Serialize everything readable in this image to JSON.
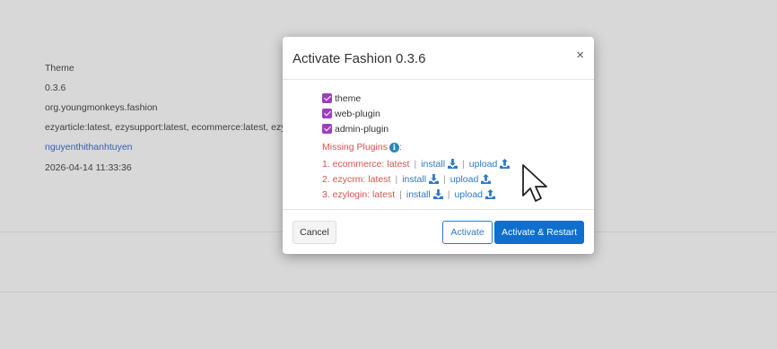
{
  "background": {
    "fields": [
      {
        "name": "theme-label",
        "text": "Theme"
      },
      {
        "name": "version-value",
        "text": "0.3.6"
      },
      {
        "name": "group-id-value",
        "text": "org.youngmonkeys.fashion"
      },
      {
        "name": "dependencies-value",
        "text": "ezyarticle:latest, ezysupport:latest, ecommerce:latest, ezy"
      },
      {
        "name": "author-link",
        "text": "nguyenthithanhtuyen"
      },
      {
        "name": "date-value",
        "text": "2026-04-14 11:33:36"
      }
    ]
  },
  "modal": {
    "title": "Activate Fashion 0.3.6",
    "close_symbol": "×",
    "checks": [
      {
        "label": "theme",
        "checked": true
      },
      {
        "label": "web-plugin",
        "checked": true
      },
      {
        "label": "admin-plugin",
        "checked": true
      }
    ],
    "missing_title": "Missing Plugins",
    "missing_suffix": ":",
    "info_symbol": "i",
    "separator": "|",
    "plugins": [
      {
        "name": "1. ecommerce: latest",
        "install": "install",
        "upload": "upload"
      },
      {
        "name": "2. ezycrm: latest",
        "install": "install",
        "upload": "upload"
      },
      {
        "name": "3. ezylogin: latest",
        "install": "install",
        "upload": "upload"
      }
    ],
    "buttons": {
      "cancel": "Cancel",
      "activate": "Activate",
      "activate_restart": "Activate & Restart"
    }
  },
  "colors": {
    "checkbox": "#9c3fbf",
    "missing": "#d9534f",
    "link": "#2e79c7",
    "primary": "#0f6fcf"
  },
  "icons": [
    "close-icon",
    "checkmark-icon",
    "info-icon",
    "download-icon",
    "upload-icon",
    "mouse-pointer-icon"
  ]
}
